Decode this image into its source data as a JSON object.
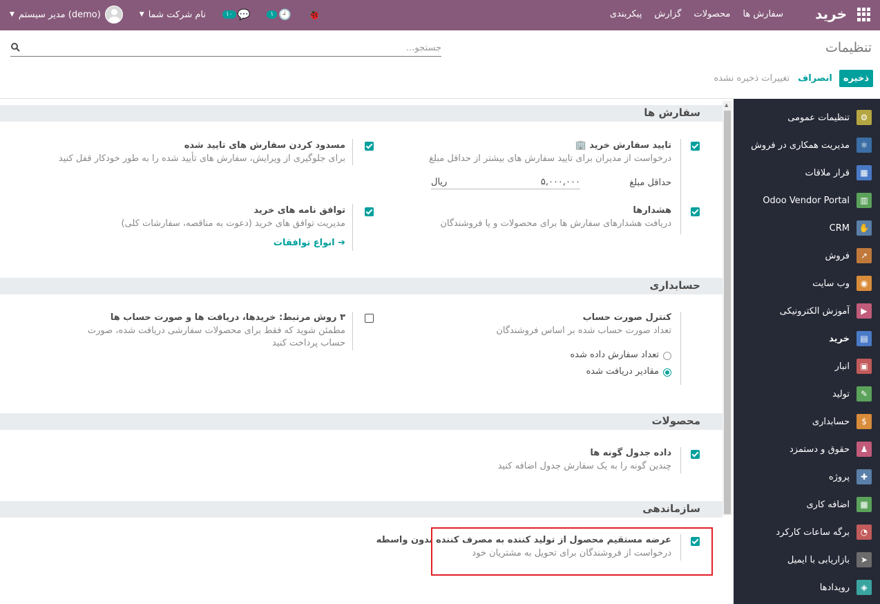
{
  "navbar": {
    "brand": "خرید",
    "menu": [
      "سفارش ها",
      "محصولات",
      "گزارش",
      "پیکربندی"
    ],
    "activity_count": "۱",
    "messages_count": "۱۰",
    "company": "نام شرکت شما",
    "user": "مدیر سیستم (demo)"
  },
  "control_panel": {
    "title": "تنظیمات",
    "search_placeholder": "جستجو...",
    "save_label": "ذخیره",
    "discard_label": "انصراف",
    "unsaved_label": "تغییرات ذخیره نشده"
  },
  "sidebar": {
    "items": [
      {
        "label": "تنظیمات عمومی",
        "icon": "gear-icon",
        "color": "#b5a642"
      },
      {
        "label": "مدیریت همکاری در فروش",
        "icon": "network-icon",
        "color": "#3a6ea5"
      },
      {
        "label": "قرار ملاقات",
        "icon": "calendar-icon",
        "color": "#4a7ac7"
      },
      {
        "label": "Odoo Vendor Portal",
        "icon": "grid-icon",
        "color": "#5ba25b"
      },
      {
        "label": "CRM",
        "icon": "handshake-icon",
        "color": "#5a7fa8"
      },
      {
        "label": "فروش",
        "icon": "chart-icon",
        "color": "#c0793a"
      },
      {
        "label": "وب سایت",
        "icon": "globe-icon",
        "color": "#d98c3a"
      },
      {
        "label": "آموزش الکترونیکی",
        "icon": "elearning-icon",
        "color": "#c25b7a"
      },
      {
        "label": "خرید",
        "icon": "purchase-icon",
        "color": "#4a7ac7"
      },
      {
        "label": "انبار",
        "icon": "box-icon",
        "color": "#c25b5b"
      },
      {
        "label": "تولید",
        "icon": "wrench-icon",
        "color": "#5ba25b"
      },
      {
        "label": "حسابداری",
        "icon": "invoice-icon",
        "color": "#d98c3a"
      },
      {
        "label": "حقوق و دستمزد",
        "icon": "payroll-icon",
        "color": "#c25b7a"
      },
      {
        "label": "پروژه",
        "icon": "puzzle-icon",
        "color": "#5a7fa8"
      },
      {
        "label": "اضافه کاری",
        "icon": "overtime-icon",
        "color": "#5ba25b"
      },
      {
        "label": "برگه ساعات کارکرد",
        "icon": "stopwatch-icon",
        "color": "#c25b5b"
      },
      {
        "label": "بازاریابی با ایمیل",
        "icon": "paper-plane-icon",
        "color": "#6b6b6b"
      },
      {
        "label": "رویدادها",
        "icon": "ticket-icon",
        "color": "#3aa5a0"
      }
    ],
    "active_index": 8
  },
  "sections": {
    "orders": "سفارش ها",
    "accounting": "حسابداری",
    "products": "محصولات",
    "logistics": "سازماندهی"
  },
  "settings": {
    "po_approval": {
      "title": "تایید سفارش خرید",
      "desc": "درخواست از مدیران برای تایید سفارش های بیشتر از حداقل مبلغ",
      "field_label": "حداقل مبلغ",
      "field_value": "۵,۰۰۰,۰۰۰",
      "currency": "ریال"
    },
    "lock_orders": {
      "title": "مسدود کردن سفارش های تایید شده",
      "desc": "برای جلوگیری از ویرایش، سفارش های تأیید شده را به طور خودکار قفل کنید"
    },
    "warnings": {
      "title": "هشدارها",
      "desc": "دریافت هشدارهای سفارش ها برای محصولات و یا فروشندگان"
    },
    "agreements": {
      "title": "توافق نامه های خرید",
      "desc": "مدیریت توافق های خرید (دعوت به مناقصه، سفارشات کلی)",
      "link": "انواع توافقات"
    },
    "bill_control": {
      "title": "کنترل صورت حساب",
      "desc": "تعداد صورت حساب شده بر اساس فروشندگان",
      "option_ordered": "تعداد سفارش داده شده",
      "option_received": "مقادیر دریافت شده"
    },
    "three_way": {
      "title": "۳ روش مرتبط: خریدها، دریافت ها و صورت حساب ها",
      "desc": "مطمئن شوید که فقط برای محصولات سفارشی دریافت شده، صورت حساب پرداخت کنید"
    },
    "variants": {
      "title": "داده جدول گونه ها",
      "desc": "چندین گونه را به یک سفارش جدول اضافه کنید"
    },
    "dropship": {
      "title": "عرضه مستقیم محصول از تولید کننده به مصرف کننده بدون واسطه",
      "desc": "درخواست از فروشندگان برای تحویل به مشتریان خود"
    }
  }
}
